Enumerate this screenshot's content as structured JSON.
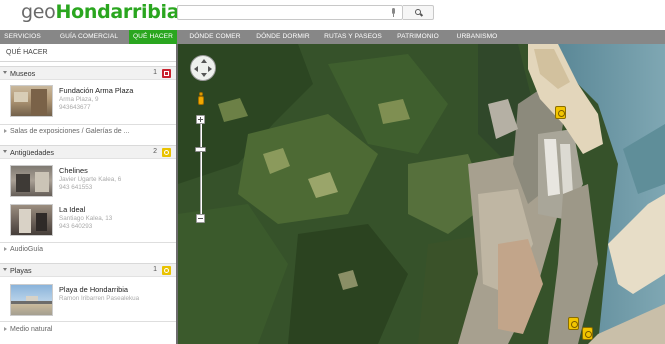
{
  "header": {
    "logo_prefix": "geo",
    "logo_brand": "Hondarribia",
    "search": {
      "value": "",
      "placeholder": ""
    }
  },
  "nav": {
    "items": [
      {
        "label": "Servicios",
        "active": false
      },
      {
        "label": "Guía comercial",
        "active": false
      },
      {
        "label": "Qué hacer",
        "active": true
      },
      {
        "label": "Dónde comer",
        "active": false
      },
      {
        "label": "Dónde dormir",
        "active": false
      },
      {
        "label": "Rutas y paseos",
        "active": false
      },
      {
        "label": "Patrimonio",
        "active": false
      },
      {
        "label": "Urbanismo",
        "active": false
      }
    ]
  },
  "sidebar": {
    "title": "QUÉ HACER",
    "museos": {
      "label": "Museos",
      "count": "1",
      "icon": "museum-icon",
      "color": "#c9212e",
      "entries": [
        {
          "name": "Fundación Arma Plaza",
          "address": "Arma Plaza, 9",
          "phone": "943643677"
        }
      ]
    },
    "salas_label": "Salas de exposiciones / Galerías de ...",
    "antiguedades": {
      "label": "Antigüedades",
      "count": "2",
      "icon": "antiques-icon",
      "color": "#e9c200",
      "entries": [
        {
          "name": "Chelines",
          "address": "Javier Ugarte Kalea, 6",
          "phone": "943 641553"
        },
        {
          "name": "La Ideal",
          "address": "Santiago Kalea, 13",
          "phone": "943 640293"
        }
      ]
    },
    "audioguia_label": "AudioGuía",
    "playas": {
      "label": "Playas",
      "count": "1",
      "icon": "beach-icon",
      "color": "#e9c200",
      "entries": [
        {
          "name": "Playa de Hondarribia",
          "address": "Ramon Iribarren Pasealekua"
        }
      ]
    },
    "medio_label": "Medio natural"
  }
}
